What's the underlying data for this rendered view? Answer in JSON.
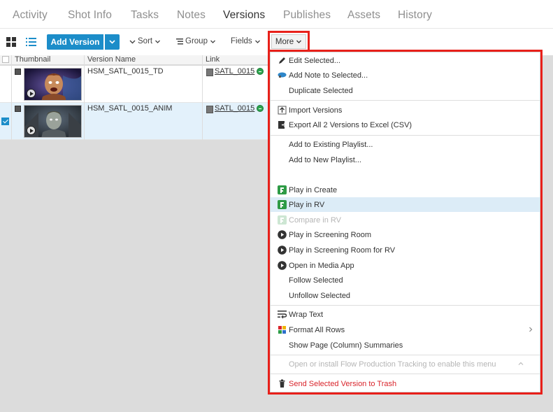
{
  "tabs": [
    "Activity",
    "Shot Info",
    "Tasks",
    "Notes",
    "Versions",
    "Publishes",
    "Assets",
    "History"
  ],
  "active_tab": "Versions",
  "toolbar": {
    "add_version": "Add Version",
    "sort": "Sort",
    "group": "Group",
    "fields": "Fields",
    "more": "More"
  },
  "grid": {
    "headers": {
      "thumbnail": "Thumbnail",
      "version_name": "Version Name",
      "link": "Link"
    },
    "rows": [
      {
        "name": "HSM_SATL_0015_TD",
        "link": "SATL_0015",
        "selected": false
      },
      {
        "name": "HSM_SATL_0015_ANIM",
        "link": "SATL_0015",
        "selected": true
      }
    ]
  },
  "menu": {
    "edit_selected": "Edit Selected...",
    "add_note": "Add Note to Selected...",
    "duplicate": "Duplicate Selected",
    "import_versions": "Import Versions",
    "export_excel": "Export All 2 Versions to Excel (CSV)",
    "add_existing_playlist": "Add to Existing Playlist...",
    "add_new_playlist": "Add to New Playlist...",
    "play_create": "Play in Create",
    "play_rv": "Play in RV",
    "compare_rv": "Compare in RV",
    "play_screening": "Play in Screening Room",
    "play_screening_rv": "Play in Screening Room for RV",
    "open_media_app": "Open in Media App",
    "follow": "Follow Selected",
    "unfollow": "Unfollow Selected",
    "wrap_text": "Wrap Text",
    "format_rows": "Format All Rows",
    "show_summaries": "Show Page (Column) Summaries",
    "open_install": "Open or install Flow Production Tracking to enable this menu",
    "send_trash": "Send Selected Version to Trash"
  },
  "colors": {
    "accent": "#1c8dc9",
    "highlight": "#e8201a",
    "danger": "#d9242b",
    "selected_row": "#e3f1fb"
  }
}
